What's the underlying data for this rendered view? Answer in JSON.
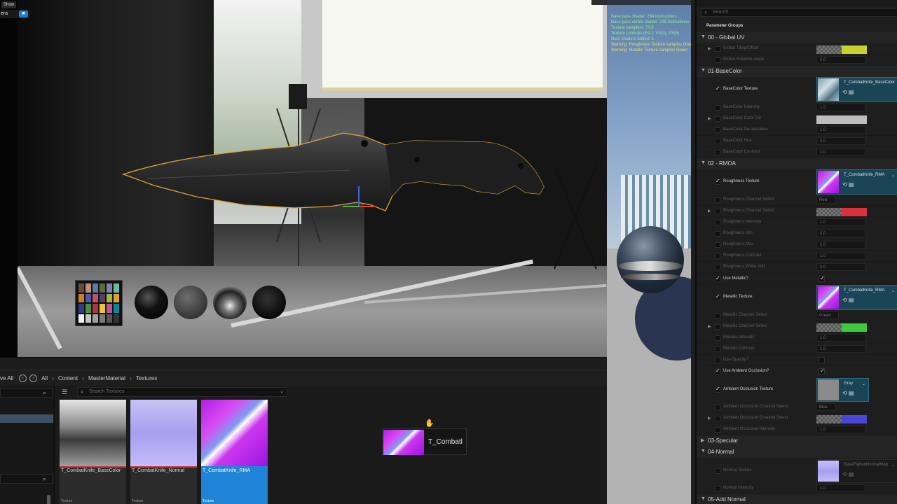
{
  "viewport": {
    "topleft_chip": "Show",
    "camera_label": "era",
    "camera_icon": "video-camera-icon"
  },
  "content_browser": {
    "save_all_label": "ve All",
    "breadcrumb": [
      "All",
      "Content",
      "MasterMaterial",
      "Textures"
    ],
    "search_placeholder": "Search Textures",
    "assets": [
      {
        "name": "T_CombatKnife_BaseColor",
        "type": "Texture"
      },
      {
        "name": "T_CombatKnife_Normal",
        "type": "Texture"
      },
      {
        "name": "T_CombatKnife_RMA",
        "type": "Texture"
      }
    ],
    "drag_label": "T_Combatl"
  },
  "preview": {
    "stats": [
      "Base pass shader: 294 instructions",
      "Base pass vertex shader: 135 instructions",
      "Texture samplers: 7/16",
      "Texture Lookups (Est.): VS(0), PS(5)",
      "Num shaders added: 6"
    ],
    "warnings": [
      "Warning: Roughness Texture samples Green",
      "Warning: Metallic Texture samples Green"
    ]
  },
  "details": {
    "search_placeholder": "Search",
    "title": "Parameter Groups",
    "groups": {
      "global_uv": "00 - Global UV",
      "basecolor": "01-BaseColor",
      "rmoa": "02 - RMOA",
      "specular": "03-Specular",
      "normal": "04-Normal",
      "add_normal": "05-Add Normal"
    },
    "global_tiling": "Global Tiling/Offset",
    "global_rotation": "Global Rotation Angle",
    "global_rotation_val": "0.0",
    "basecolor_texture": "BaseColor Texture",
    "basecolor_texture_name": "T_CombatKnife_BaseColor",
    "basecolor_intensity": "BaseColor Intensity",
    "basecolor_intensity_val": "1.0",
    "basecolor_tint": "BaseColor ColorTint",
    "basecolor_desat": "BaseColor Desaturation",
    "basecolor_desat_val": "1.0",
    "basecolor_hue": "BaseColor Hue",
    "basecolor_hue_val": "0.0",
    "basecolor_contrast": "BaseColor Contrast",
    "basecolor_contrast_val": "1.0",
    "roughness_texture": "Roughness Texture",
    "roughness_texture_name": "T_CombatKnife_RMA",
    "roughness_channel_select": "Roughness Channel Select",
    "roughness_channel_select_val": "Red",
    "roughness_channel_select2": "Roughness Channel Select",
    "roughness_intensity": "Roughness Intensity",
    "roughness_intensity_val": "1.0",
    "roughness_min": "Roughness Min",
    "roughness_min_val": "0.0",
    "roughness_max": "Roughness Max",
    "roughness_max_val": "1.0",
    "roughness_contrast": "Roughness Contrast",
    "roughness_contrast_val": "1.0",
    "roughness_white_add": "Roughness White Add",
    "roughness_white_add_val": "0.0",
    "use_metallic": "Use Metallic?",
    "metallic_texture": "Metallic Texture",
    "metallic_texture_name": "T_CombatKnife_RMA",
    "metallic_channel_select": "Metallic Channel Select",
    "metallic_channel_select_val": "Green",
    "metallic_channel_select2": "Metallic Channel Select",
    "metallic_intensity": "Metallic Intensity",
    "metallic_intensity_val": "1.0",
    "metallic_contrast": "Metallic Contrast",
    "metallic_contrast_val": "1.0",
    "use_opacity": "Use Opacity?",
    "use_ao": "Use Ambient Occlusion?",
    "ao_texture": "Ambient Occlusion Texture",
    "ao_texture_name": "Gray",
    "ao_channel_select": "Ambient Occlusion Channel Select",
    "ao_channel_select_val": "Blue",
    "ao_channel_select2": "Ambient Occlusion Channel Select",
    "ao_intensity": "Ambient Occlusion Intensity",
    "ao_intensity_val": "1.0",
    "normal_texture": "Normal Texture",
    "normal_texture_name": "BaseFlattenNormalMap",
    "normal_intensity": "Normal Intensity",
    "normal_intensity_val": "1.0"
  },
  "colors": {
    "selection_blue": "#1f84d8",
    "rough_channel": "#d9323a",
    "metal_channel": "#3ec93e",
    "ao_channel": "#4a46d6",
    "global_tiling": "#c8d12d",
    "basecolor_tint": "#bdbdbd"
  }
}
